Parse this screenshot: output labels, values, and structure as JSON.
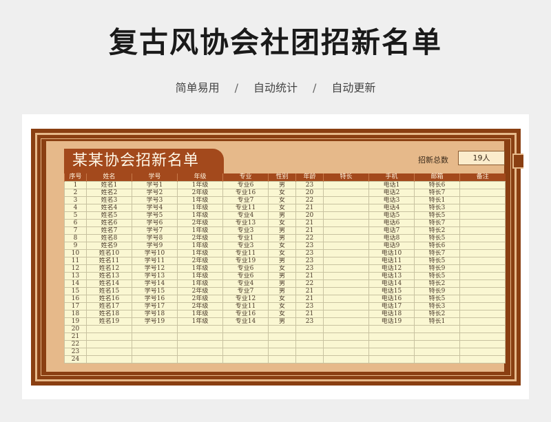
{
  "page": {
    "title": "复古风协会社团招新名单",
    "subtitle": [
      "简单易用",
      "自动统计",
      "自动更新"
    ],
    "subtitle_sep": "/"
  },
  "sheet": {
    "title": "某某协会招新名单",
    "total_label": "招新总数",
    "total_value": "19人",
    "columns": [
      "序号",
      "姓名",
      "学号",
      "年级",
      "专业",
      "性别",
      "年龄",
      "特长",
      "手机",
      "邮箱",
      "备注"
    ],
    "rows": [
      [
        "1",
        "姓名1",
        "学号1",
        "1年级",
        "专业6",
        "男",
        "23",
        "",
        "电话1",
        "特长6",
        ""
      ],
      [
        "2",
        "姓名2",
        "学号2",
        "2年级",
        "专业16",
        "女",
        "20",
        "",
        "电话2",
        "特长7",
        ""
      ],
      [
        "3",
        "姓名3",
        "学号3",
        "1年级",
        "专业7",
        "女",
        "22",
        "",
        "电话3",
        "特长1",
        ""
      ],
      [
        "4",
        "姓名4",
        "学号4",
        "1年级",
        "专业11",
        "女",
        "21",
        "",
        "电话4",
        "特长3",
        ""
      ],
      [
        "5",
        "姓名5",
        "学号5",
        "1年级",
        "专业4",
        "男",
        "20",
        "",
        "电话5",
        "特长5",
        ""
      ],
      [
        "6",
        "姓名6",
        "学号6",
        "2年级",
        "专业13",
        "女",
        "21",
        "",
        "电话6",
        "特长7",
        ""
      ],
      [
        "7",
        "姓名7",
        "学号7",
        "1年级",
        "专业3",
        "男",
        "21",
        "",
        "电话7",
        "特长2",
        ""
      ],
      [
        "8",
        "姓名8",
        "学号8",
        "2年级",
        "专业1",
        "男",
        "22",
        "",
        "电话8",
        "特长5",
        ""
      ],
      [
        "9",
        "姓名9",
        "学号9",
        "1年级",
        "专业3",
        "女",
        "23",
        "",
        "电话9",
        "特长6",
        ""
      ],
      [
        "10",
        "姓名10",
        "学号10",
        "1年级",
        "专业11",
        "女",
        "23",
        "",
        "电话10",
        "特长7",
        ""
      ],
      [
        "11",
        "姓名11",
        "学号11",
        "2年级",
        "专业19",
        "男",
        "23",
        "",
        "电话11",
        "特长5",
        ""
      ],
      [
        "12",
        "姓名12",
        "学号12",
        "1年级",
        "专业6",
        "女",
        "23",
        "",
        "电话12",
        "特长9",
        ""
      ],
      [
        "13",
        "姓名13",
        "学号13",
        "1年级",
        "专业6",
        "男",
        "21",
        "",
        "电话13",
        "特长5",
        ""
      ],
      [
        "14",
        "姓名14",
        "学号14",
        "1年级",
        "专业4",
        "男",
        "22",
        "",
        "电话14",
        "特长2",
        ""
      ],
      [
        "15",
        "姓名15",
        "学号15",
        "2年级",
        "专业7",
        "男",
        "21",
        "",
        "电话15",
        "特长9",
        ""
      ],
      [
        "16",
        "姓名16",
        "学号16",
        "2年级",
        "专业12",
        "女",
        "21",
        "",
        "电话16",
        "特长5",
        ""
      ],
      [
        "17",
        "姓名17",
        "学号17",
        "2年级",
        "专业11",
        "女",
        "23",
        "",
        "电话17",
        "特长3",
        ""
      ],
      [
        "18",
        "姓名18",
        "学号18",
        "1年级",
        "专业16",
        "女",
        "21",
        "",
        "电话18",
        "特长2",
        ""
      ],
      [
        "19",
        "姓名19",
        "学号19",
        "1年级",
        "专业14",
        "男",
        "23",
        "",
        "电话19",
        "特长1",
        ""
      ],
      [
        "20",
        "",
        "",
        "",
        "",
        "",
        "",
        "",
        "",
        "",
        ""
      ],
      [
        "21",
        "",
        "",
        "",
        "",
        "",
        "",
        "",
        "",
        "",
        ""
      ],
      [
        "22",
        "",
        "",
        "",
        "",
        "",
        "",
        "",
        "",
        "",
        ""
      ],
      [
        "23",
        "",
        "",
        "",
        "",
        "",
        "",
        "",
        "",
        "",
        ""
      ],
      [
        "24",
        "",
        "",
        "",
        "",
        "",
        "",
        "",
        "",
        "",
        ""
      ]
    ]
  }
}
